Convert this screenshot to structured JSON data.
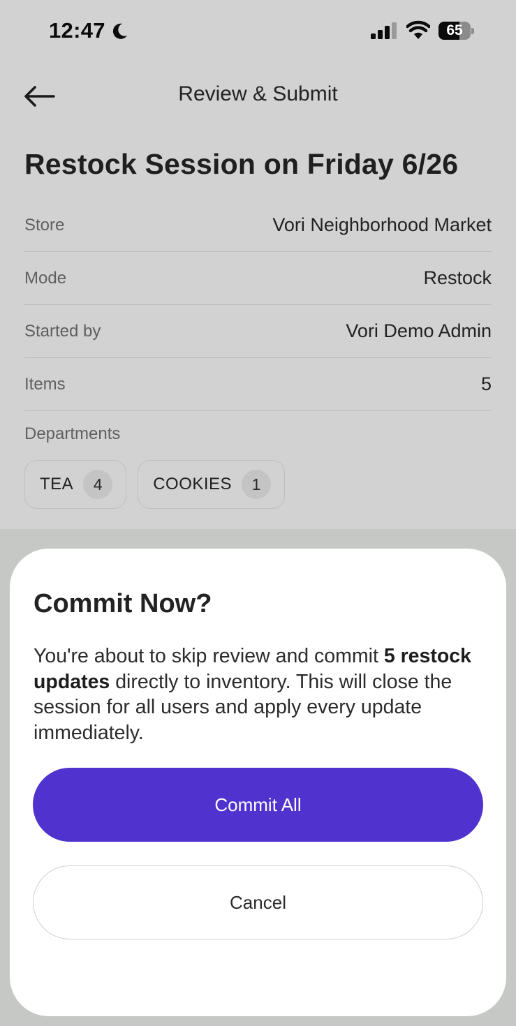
{
  "status_bar": {
    "time": "12:47",
    "battery_level": "65",
    "battery_fraction": 0.65,
    "icons": [
      "moon-icon",
      "signal-icon",
      "wifi-icon",
      "battery-icon"
    ]
  },
  "header": {
    "back_icon": "arrow-left-icon",
    "title": "Review & Submit"
  },
  "session": {
    "title": "Restock Session on Friday 6/26",
    "details": [
      {
        "label": "Store",
        "value": "Vori Neighborhood Market"
      },
      {
        "label": "Mode",
        "value": "Restock"
      },
      {
        "label": "Started by",
        "value": "Vori Demo Admin"
      },
      {
        "label": "Items",
        "value": "5"
      }
    ],
    "departments_label": "Departments",
    "departments": [
      {
        "name": "TEA",
        "count": "4"
      },
      {
        "name": "COOKIES",
        "count": "1"
      }
    ]
  },
  "modal": {
    "title": "Commit Now?",
    "body_intro": "You're about to skip review and commit ",
    "body_bold": "5 restock updates",
    "body_rest": " directly to inventory. This will close the session for all users and apply every update immediately.",
    "commit_label": "Commit All",
    "cancel_label": "Cancel"
  },
  "colors": {
    "primary": "#5033cf",
    "backdrop": "#d2d2d2",
    "sheet": "#ffffff"
  }
}
